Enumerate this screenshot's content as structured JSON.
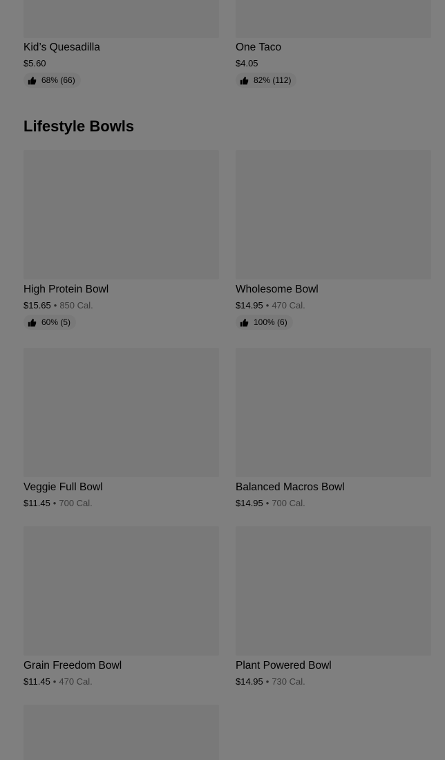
{
  "top_items": [
    {
      "name": "Kid’s Quesadilla",
      "price": "$5.60",
      "rating": "68% (66)"
    },
    {
      "name": "One Taco",
      "price": "$4.05",
      "rating": "82% (112)"
    }
  ],
  "section": {
    "title": "Lifestyle Bowls",
    "items": [
      {
        "name": "High Protein Bowl",
        "price": "$15.65",
        "calories": "850 Cal.",
        "rating": "60% (5)"
      },
      {
        "name": "Wholesome Bowl",
        "price": "$14.95",
        "calories": "470 Cal.",
        "rating": "100% (6)"
      },
      {
        "name": "Veggie Full Bowl",
        "price": "$11.45",
        "calories": "700 Cal."
      },
      {
        "name": "Balanced Macros Bowl",
        "price": "$14.95",
        "calories": "700 Cal."
      },
      {
        "name": "Grain Freedom Bowl",
        "price": "$11.45",
        "calories": "470 Cal."
      },
      {
        "name": "Plant Powered Bowl",
        "price": "$14.95",
        "calories": "730 Cal."
      }
    ]
  },
  "separator": "•",
  "icons": {
    "rating": "thumbs-up-icon"
  },
  "colors": {
    "overlay": "rgba(0,0,0,0.5)",
    "placeholder": "#f3f3f3"
  }
}
